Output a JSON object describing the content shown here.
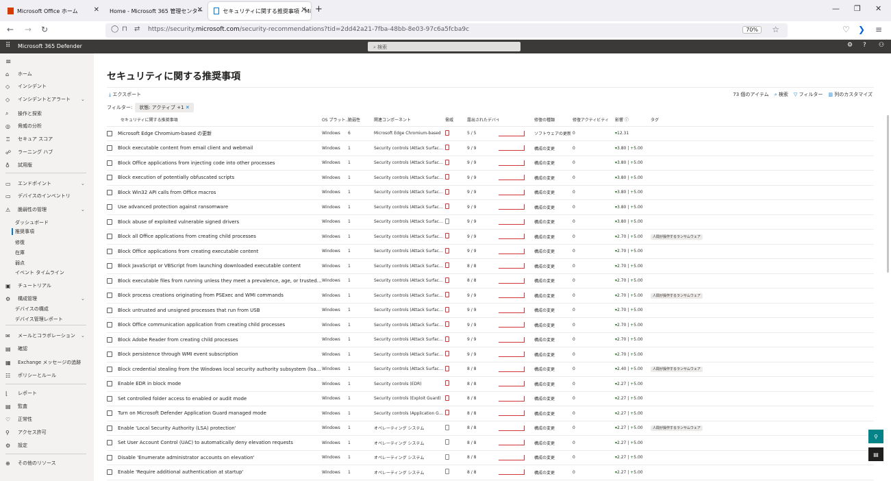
{
  "browser": {
    "tabs": [
      {
        "label": "Microsoft Office ホーム",
        "active": false
      },
      {
        "label": "Home - Microsoft 365 管理センター",
        "active": false
      },
      {
        "label": "セキュリティに関する推奨事項 - Mi",
        "active": true
      }
    ],
    "url_prefix": "https://security.",
    "url_domain": "microsoft.com",
    "url_path": "/security-recommendations?tid=2dd42a21-7fba-48bb-8e03-97c6a5fcba9c",
    "zoom": "70%"
  },
  "header": {
    "brand": "Microsoft 365 Defender",
    "search_placeholder": "検索"
  },
  "sidebar": {
    "items": [
      {
        "icon": "home-icon",
        "glyph": "⌂",
        "label": "ホーム"
      },
      {
        "icon": "shield-icon",
        "glyph": "◇",
        "label": "インシデント"
      },
      {
        "icon": "shield-alert-icon",
        "glyph": "◇",
        "label": "インシデントとアラート"
      },
      {
        "icon": "hunting-icon",
        "glyph": "⌕",
        "label": "操作と探索"
      },
      {
        "icon": "analytics-icon",
        "glyph": "◎",
        "label": "脅威の分析"
      },
      {
        "icon": "trophy-icon",
        "glyph": "♖",
        "label": "セキュア スコア"
      },
      {
        "icon": "learning-icon",
        "glyph": "☍",
        "label": "ラーニング ハブ"
      },
      {
        "icon": "trial-icon",
        "glyph": "♁",
        "label": "試用版"
      },
      {
        "icon": "endpoint-icon",
        "glyph": "▭",
        "label": "エンドポイント"
      },
      {
        "icon": "device-icon",
        "glyph": "▭",
        "label": "デバイスのインベントリ"
      },
      {
        "icon": "vuln-icon",
        "glyph": "⚠",
        "label": "脆弱性の管理"
      },
      {
        "icon": "",
        "glyph": "",
        "label": "ダッシュボード"
      },
      {
        "icon": "",
        "glyph": "",
        "label": "推奨事項"
      },
      {
        "icon": "",
        "glyph": "",
        "label": "修復"
      },
      {
        "icon": "",
        "glyph": "",
        "label": "在庫"
      },
      {
        "icon": "",
        "glyph": "",
        "label": "弱点"
      },
      {
        "icon": "",
        "glyph": "",
        "label": "イベント タイムライン"
      },
      {
        "icon": "tutorial-icon",
        "glyph": "▣",
        "label": "チュートリアル"
      },
      {
        "icon": "config-icon",
        "glyph": "⚙",
        "label": "構成管理"
      },
      {
        "icon": "",
        "glyph": "",
        "label": "デバイスの構成"
      },
      {
        "icon": "",
        "glyph": "",
        "label": "デバイス管理レポート"
      },
      {
        "icon": "mail-icon",
        "glyph": "✉",
        "label": "メールとコラボレーション"
      },
      {
        "icon": "review-icon",
        "glyph": "▤",
        "label": "確認"
      },
      {
        "icon": "exchange-icon",
        "glyph": "▦",
        "label": "Exchange メッセージの追跡"
      },
      {
        "icon": "policy-icon",
        "glyph": "☷",
        "label": "ポリシーとルール"
      },
      {
        "icon": "report-icon",
        "glyph": "⌊",
        "label": "レポート"
      },
      {
        "icon": "audit-icon",
        "glyph": "▤",
        "label": "監査"
      },
      {
        "icon": "health-icon",
        "glyph": "♡",
        "label": "正常性"
      },
      {
        "icon": "permissions-icon",
        "glyph": "⚲",
        "label": "アクセス許可"
      },
      {
        "icon": "settings-icon",
        "glyph": "⚙",
        "label": "設定"
      },
      {
        "icon": "more-icon",
        "glyph": "⊕",
        "label": "その他のリソース"
      }
    ]
  },
  "main": {
    "title": "セキュリティに関する推奨事項",
    "export": "エクスポート",
    "count": "73 個のアイテム",
    "search": "検索",
    "filter": "フィルター",
    "customize": "列のカスタマイズ",
    "filter_label": "フィルター:",
    "filter_pill": "状態: アクティブ +1",
    "columns": [
      "セキュリティに関する推奨事項",
      "OS プラット...",
      "脆弱性",
      "関連コンポーネント",
      "脅威",
      "露出されたデバイス",
      "",
      "修復の種類",
      "修復アクティビティ",
      "影響 ⓘ",
      "タグ"
    ],
    "rows": [
      {
        "name": "Microsoft Edge Chromium-based の更新",
        "os": "Windows",
        "vuln": "6",
        "comp": "Microsoft Edge Chromium-based",
        "exposed": "5 / 5",
        "remed": "ソフトウェアの更新",
        "act": "0",
        "impact_down": "12.31",
        "impact_up": "",
        "tag": ""
      },
      {
        "name": "Block executable content from email client and webmail",
        "os": "Windows",
        "vuln": "1",
        "comp": "Security controls (Attack Surface Redu...",
        "exposed": "9 / 9",
        "remed": "構成の変更",
        "act": "0",
        "impact_down": "3.80",
        "impact_up": "5.00",
        "tag": ""
      },
      {
        "name": "Block Office applications from injecting code into other processes",
        "os": "Windows",
        "vuln": "1",
        "comp": "Security controls (Attack Surface Redu...",
        "exposed": "9 / 9",
        "remed": "構成の変更",
        "act": "0",
        "impact_down": "3.80",
        "impact_up": "5.00",
        "tag": ""
      },
      {
        "name": "Block execution of potentially obfuscated scripts",
        "os": "Windows",
        "vuln": "1",
        "comp": "Security controls (Attack Surface Redu...",
        "exposed": "9 / 9",
        "remed": "構成の変更",
        "act": "0",
        "impact_down": "3.80",
        "impact_up": "5.00",
        "tag": ""
      },
      {
        "name": "Block Win32 API calls from Office macros",
        "os": "Windows",
        "vuln": "1",
        "comp": "Security controls (Attack Surface Redu...",
        "exposed": "9 / 9",
        "remed": "構成の変更",
        "act": "0",
        "impact_down": "3.80",
        "impact_up": "5.00",
        "tag": ""
      },
      {
        "name": "Use advanced protection against ransomware",
        "os": "Windows",
        "vuln": "1",
        "comp": "Security controls (Attack Surface Redu...",
        "exposed": "9 / 9",
        "remed": "構成の変更",
        "act": "0",
        "impact_down": "3.80",
        "impact_up": "5.00",
        "tag": ""
      },
      {
        "name": "Block abuse of exploited vulnerable signed drivers",
        "os": "Windows",
        "vuln": "1",
        "comp": "Security controls (Attack Surface Redu...",
        "exposed": "9 / 9",
        "remed": "構成の変更",
        "act": "0",
        "impact_down": "3.80",
        "impact_up": "5.00",
        "tag": ""
      },
      {
        "name": "Block all Office applications from creating child processes",
        "os": "Windows",
        "vuln": "1",
        "comp": "Security controls (Attack Surface Redu...",
        "exposed": "9 / 9",
        "remed": "構成の変更",
        "act": "0",
        "impact_down": "2.70",
        "impact_up": "5.00",
        "tag": "人間が操作するランサムウェア"
      },
      {
        "name": "Block Office applications from creating executable content",
        "os": "Windows",
        "vuln": "1",
        "comp": "Security controls (Attack Surface Redu...",
        "exposed": "9 / 9",
        "remed": "構成の変更",
        "act": "0",
        "impact_down": "2.70",
        "impact_up": "5.00",
        "tag": ""
      },
      {
        "name": "Block JavaScript or VBScript from launching downloaded executable content",
        "os": "Windows",
        "vuln": "1",
        "comp": "Security controls (Attack Surface Redu...",
        "exposed": "8 / 8",
        "remed": "構成の変更",
        "act": "0",
        "impact_down": "2.70",
        "impact_up": "5.00",
        "tag": ""
      },
      {
        "name": "Block executable files from running unless they meet a prevalence, age, or trusted list criterion",
        "os": "Windows",
        "vuln": "1",
        "comp": "Security controls (Attack Surface Redu...",
        "exposed": "8 / 8",
        "remed": "構成の変更",
        "act": "0",
        "impact_down": "2.70",
        "impact_up": "5.00",
        "tag": ""
      },
      {
        "name": "Block process creations originating from PSExec and WMI commands",
        "os": "Windows",
        "vuln": "1",
        "comp": "Security controls (Attack Surface Redu...",
        "exposed": "9 / 9",
        "remed": "構成の変更",
        "act": "0",
        "impact_down": "2.70",
        "impact_up": "5.00",
        "tag": "人間が操作するランサムウェア"
      },
      {
        "name": "Block untrusted and unsigned processes that run from USB",
        "os": "Windows",
        "vuln": "1",
        "comp": "Security controls (Attack Surface Redu...",
        "exposed": "9 / 9",
        "remed": "構成の変更",
        "act": "0",
        "impact_down": "2.70",
        "impact_up": "5.00",
        "tag": ""
      },
      {
        "name": "Block Office communication application from creating child processes",
        "os": "Windows",
        "vuln": "1",
        "comp": "Security controls (Attack Surface Redu...",
        "exposed": "9 / 9",
        "remed": "構成の変更",
        "act": "0",
        "impact_down": "2.70",
        "impact_up": "5.00",
        "tag": ""
      },
      {
        "name": "Block Adobe Reader from creating child processes",
        "os": "Windows",
        "vuln": "1",
        "comp": "Security controls (Attack Surface Redu...",
        "exposed": "9 / 9",
        "remed": "構成の変更",
        "act": "0",
        "impact_down": "2.70",
        "impact_up": "5.00",
        "tag": ""
      },
      {
        "name": "Block persistence through WMI event subscription",
        "os": "Windows",
        "vuln": "1",
        "comp": "Security controls (Attack Surface Redu...",
        "exposed": "9 / 9",
        "remed": "構成の変更",
        "act": "0",
        "impact_down": "2.70",
        "impact_up": "5.00",
        "tag": ""
      },
      {
        "name": "Block credential stealing from the Windows local security authority subsystem (lsass.exe)",
        "os": "Windows",
        "vuln": "1",
        "comp": "Security controls (Attack Surface Redu...",
        "exposed": "8 / 8",
        "remed": "構成の変更",
        "act": "0",
        "impact_down": "2.40",
        "impact_up": "5.00",
        "tag": "人間が操作するランサムウェア"
      },
      {
        "name": "Enable EDR in block mode",
        "os": "Windows",
        "vuln": "1",
        "comp": "Security controls (EDR)",
        "exposed": "8 / 8",
        "remed": "構成の変更",
        "act": "0",
        "impact_down": "2.27",
        "impact_up": "5.00",
        "tag": ""
      },
      {
        "name": "Set controlled folder access to enabled or audit mode",
        "os": "Windows",
        "vuln": "1",
        "comp": "Security controls (Exploit Guard)",
        "exposed": "8 / 8",
        "remed": "構成の変更",
        "act": "0",
        "impact_down": "2.27",
        "impact_up": "5.00",
        "tag": ""
      },
      {
        "name": "Turn on Microsoft Defender Application Guard managed mode",
        "os": "Windows",
        "vuln": "1",
        "comp": "Security controls (Application Guard)",
        "exposed": "8 / 8",
        "remed": "構成の変更",
        "act": "0",
        "impact_down": "2.27",
        "impact_up": "5.00",
        "tag": ""
      },
      {
        "name": "Enable 'Local Security Authority (LSA) protection'",
        "os": "Windows",
        "vuln": "1",
        "comp": "オペレーティング システム",
        "exposed": "8 / 8",
        "remed": "構成の変更",
        "act": "0",
        "impact_down": "2.27",
        "impact_up": "5.00",
        "tag": "人間が操作するランサムウェア"
      },
      {
        "name": "Set User Account Control (UAC) to automatically deny elevation requests",
        "os": "Windows",
        "vuln": "1",
        "comp": "オペレーティング システム",
        "exposed": "8 / 8",
        "remed": "構成の変更",
        "act": "0",
        "impact_down": "2.27",
        "impact_up": "5.00",
        "tag": ""
      },
      {
        "name": "Disable 'Enumerate administrator accounts on elevation'",
        "os": "Windows",
        "vuln": "1",
        "comp": "オペレーティング システム",
        "exposed": "8 / 8",
        "remed": "構成の変更",
        "act": "0",
        "impact_down": "2.27",
        "impact_up": "5.00",
        "tag": ""
      },
      {
        "name": "Enable 'Require additional authentication at startup'",
        "os": "Windows",
        "vuln": "1",
        "comp": "オペレーティング システム",
        "exposed": "8 / 8",
        "remed": "構成の変更",
        "act": "0",
        "impact_down": "2.27",
        "impact_up": "5.00",
        "tag": ""
      }
    ]
  }
}
